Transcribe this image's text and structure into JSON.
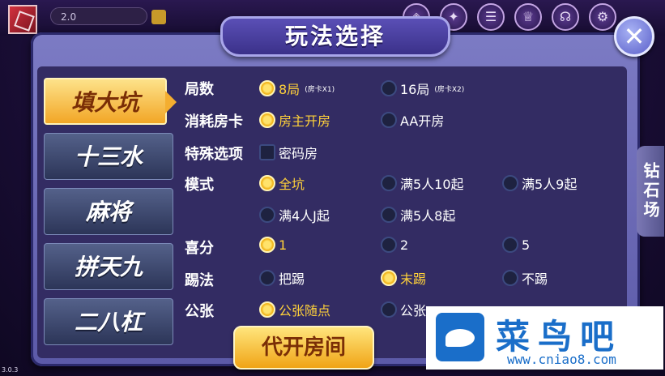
{
  "top_bar": {
    "coins": "2.0",
    "icons": [
      "shop-icon",
      "trophy-icon",
      "list-icon",
      "cup-icon",
      "headset-icon",
      "settings-icon"
    ]
  },
  "dialog": {
    "title": "玩法选择"
  },
  "tabs": [
    {
      "label": "填大坑",
      "active": true
    },
    {
      "label": "十三水",
      "active": false
    },
    {
      "label": "麻将",
      "active": false
    },
    {
      "label": "拼天九",
      "active": false
    },
    {
      "label": "二八杠",
      "active": false
    }
  ],
  "side_tab": "钻石场",
  "rows": [
    {
      "label": "局数",
      "options": [
        {
          "text": "8局",
          "note": "(房卡X1)",
          "selected": true
        },
        {
          "text": "16局",
          "note": "(房卡X2)",
          "selected": false
        }
      ]
    },
    {
      "label": "消耗房卡",
      "options": [
        {
          "text": "房主开房",
          "selected": true
        },
        {
          "text": "AA开房",
          "selected": false
        }
      ]
    },
    {
      "label": "特殊选项",
      "options": [
        {
          "text": "密码房",
          "checkbox": true
        }
      ]
    },
    {
      "label": "模式",
      "options": [
        {
          "text": "全坑",
          "selected": true
        },
        {
          "text": "满5人10起",
          "selected": false
        },
        {
          "text": "满5人9起",
          "selected": false
        },
        {
          "text": "满4人J起",
          "selected": false
        },
        {
          "text": "满5人8起",
          "selected": false
        }
      ]
    },
    {
      "label": "喜分",
      "options": [
        {
          "text": "1",
          "selected": true
        },
        {
          "text": "2",
          "selected": false
        },
        {
          "text": "5",
          "selected": false
        }
      ]
    },
    {
      "label": "踢法",
      "options": [
        {
          "text": "把踢",
          "selected": false
        },
        {
          "text": "末踢",
          "selected": true
        },
        {
          "text": "不踢",
          "selected": false
        }
      ]
    },
    {
      "label": "公张",
      "options": [
        {
          "text": "公张随点",
          "selected": true
        },
        {
          "text": "公张",
          "selected": false
        }
      ]
    }
  ],
  "create_button": "代开房间",
  "watermark": {
    "title": "菜鸟吧",
    "url": "www.cniao8.com"
  },
  "version": "3.0.3"
}
